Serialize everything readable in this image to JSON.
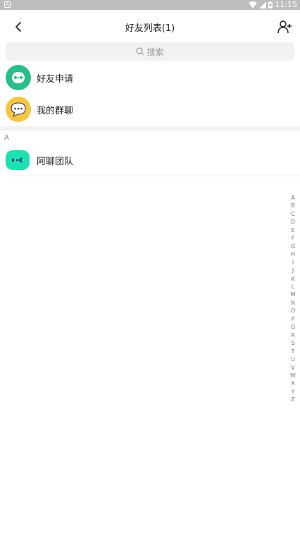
{
  "status_bar": {
    "time": "11:15",
    "left_icon_label": "A"
  },
  "header": {
    "title": "好友列表(1)"
  },
  "search": {
    "placeholder": "搜索"
  },
  "top_items": [
    {
      "label": "好友申请",
      "icon": "friend-request-icon",
      "color": "#2bbd8a"
    },
    {
      "label": "我的群聊",
      "icon": "group-chat-icon",
      "color": "#f7c544"
    }
  ],
  "section": {
    "letter": "A"
  },
  "contacts": [
    {
      "name": "阿聊团队",
      "icon": "team-avatar-icon",
      "color": "#1fe0b0"
    }
  ],
  "index_letters": [
    "A",
    "B",
    "C",
    "D",
    "E",
    "F",
    "G",
    "H",
    "I",
    "J",
    "K",
    "L",
    "M",
    "N",
    "O",
    "P",
    "Q",
    "R",
    "S",
    "T",
    "U",
    "V",
    "W",
    "X",
    "Y",
    "Z"
  ]
}
